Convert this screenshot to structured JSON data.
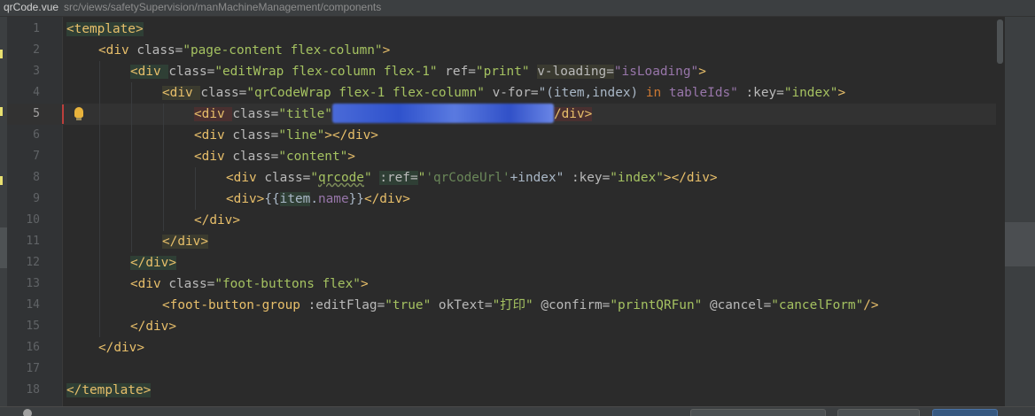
{
  "tab": {
    "filename": "qrCode.vue",
    "path": "src/views/safetySupervision/manMachineManagement/components"
  },
  "current_line": 5,
  "lines": [
    {
      "n": "1"
    },
    {
      "n": "2"
    },
    {
      "n": "3"
    },
    {
      "n": "4"
    },
    {
      "n": "5"
    },
    {
      "n": "6"
    },
    {
      "n": "7"
    },
    {
      "n": "8"
    },
    {
      "n": "9"
    },
    {
      "n": "10"
    },
    {
      "n": "11"
    },
    {
      "n": "12"
    },
    {
      "n": "13"
    },
    {
      "n": "14"
    },
    {
      "n": "15"
    },
    {
      "n": "16"
    },
    {
      "n": "17"
    },
    {
      "n": "18"
    }
  ],
  "code": {
    "l1": {
      "tag_open": "<template>"
    },
    "l2": {
      "tag": "<div ",
      "attr": "class=",
      "val": "\"page-content flex-column\"",
      "end": ">"
    },
    "l3": {
      "tag": "<div ",
      "attr": "class=",
      "val": "\"editWrap flex-column flex-1\"",
      "attr2": " ref=",
      "val2": "\"print\"",
      "attr3": "v-loading=",
      "val3": "\"isLoading\"",
      "end": ">"
    },
    "l4": {
      "tag": "<div ",
      "attr": "class=",
      "val": "\"qrCodeWrap flex-1 flex-column\"",
      "attr2": " v-for=",
      "q1": "\"(item,index) ",
      "kw": "in",
      "q2": " tableIds\"",
      "attr3": " :key=",
      "val3": "\"index\"",
      "end": ">"
    },
    "l5": {
      "tag": "<div ",
      "attr": "class=",
      "val": "\"title\"",
      "close": "/div>"
    },
    "l6": {
      "tag": "<div ",
      "attr": "class=",
      "val": "\"line\"",
      "end": "></div>"
    },
    "l7": {
      "tag": "<div ",
      "attr": "class=",
      "val": "\"content\"",
      "end": ">"
    },
    "l8": {
      "tag": "<div ",
      "attr": "class=",
      "q": "\"",
      "sq": "qrcode",
      "q2": "\"",
      "ref": ":ref=",
      "q3": "\"",
      "refval": "'qrCodeUrl'",
      "plus": "+index\"",
      "attr3": " :key=",
      "val3": "\"index\"",
      "end": "></div>"
    },
    "l9": {
      "tag": "<div>",
      "mustache_open": "{{",
      "item": "item",
      "dot": ".",
      "name": "name",
      "mustache_close": "}}",
      "end": "</div>"
    },
    "l10": {
      "tag": "</div>"
    },
    "l11": {
      "tag": "</div>"
    },
    "l12": {
      "tag": "</div>"
    },
    "l13": {
      "tag": "<div ",
      "attr": "class=",
      "val": "\"foot-buttons flex\"",
      "end": ">"
    },
    "l14": {
      "tag": "<foot-button-group ",
      "attr": ":editFlag=",
      "val": "\"true\"",
      "attr2": " okText=",
      "val2": "\"打印\"",
      "attr3": " @confirm=",
      "val3": "\"printQRFun\"",
      "attr4": " @cancel=",
      "val4": "\"cancelForm\"",
      "end": "/>"
    },
    "l15": {
      "tag": "</div>"
    },
    "l16": {
      "tag": "</div>"
    },
    "l18": {
      "tag": "</template>"
    }
  },
  "colors": {
    "background": "#2b2b2b",
    "tag": "#e8bf6a",
    "string": "#6a8759",
    "keyword": "#cc7832"
  },
  "icons": {
    "bulb": "lightbulb-icon",
    "settings": "gear-icon"
  }
}
